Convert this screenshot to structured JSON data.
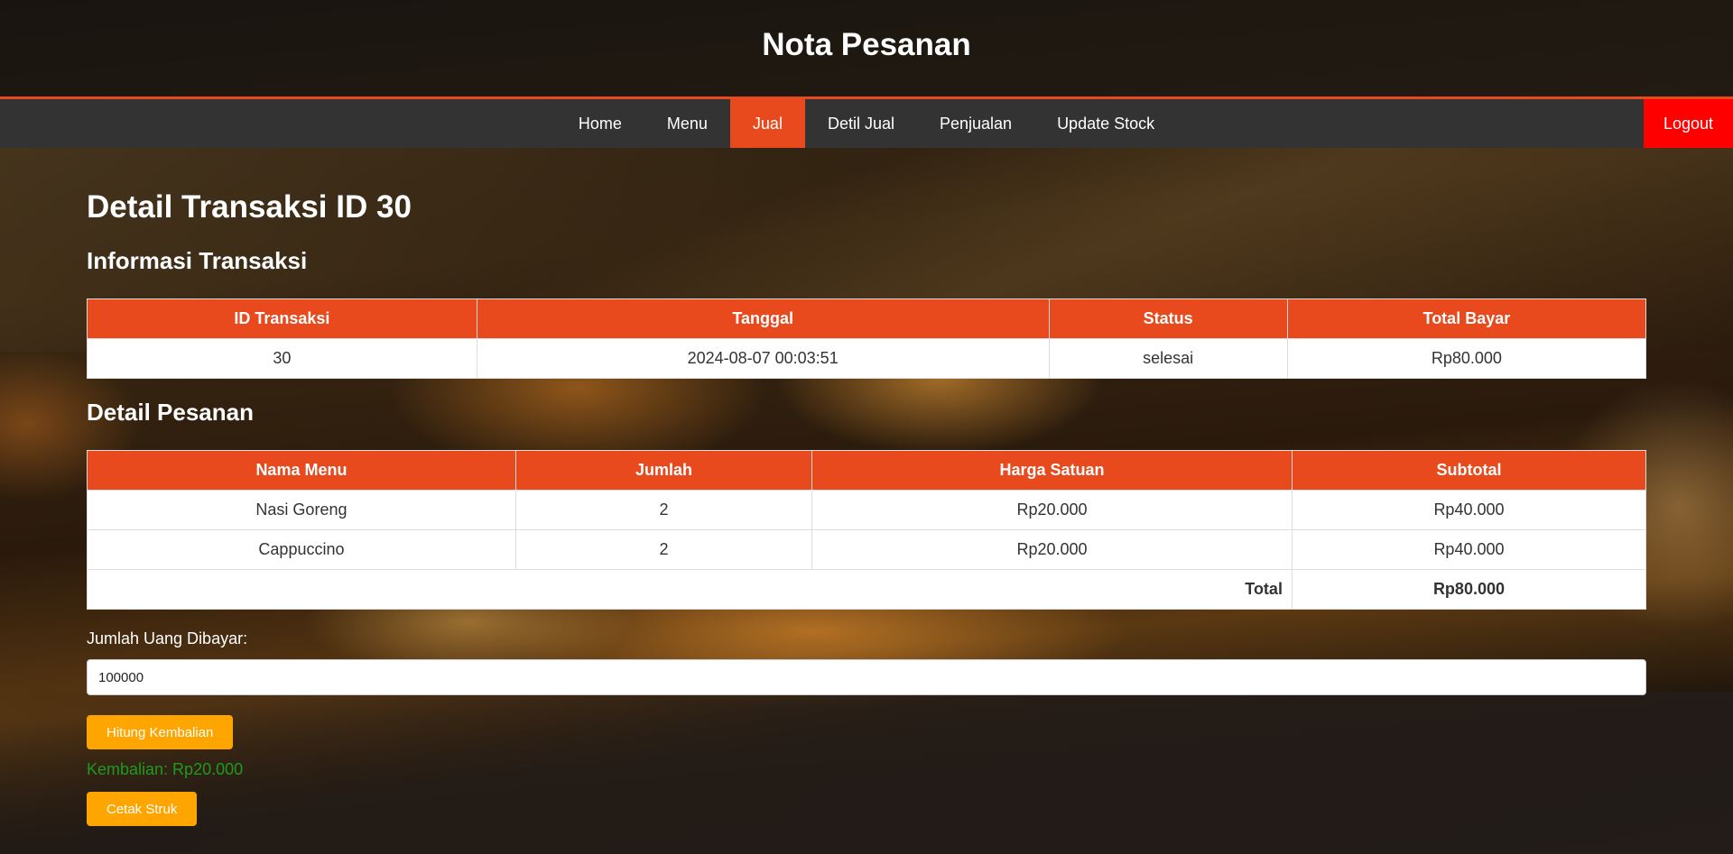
{
  "header": {
    "title": "Nota Pesanan"
  },
  "nav": {
    "items": [
      {
        "label": "Home"
      },
      {
        "label": "Menu"
      },
      {
        "label": "Jual"
      },
      {
        "label": "Detil Jual"
      },
      {
        "label": "Penjualan"
      },
      {
        "label": "Update Stock"
      }
    ],
    "active": "Jual",
    "logout": "Logout"
  },
  "page": {
    "title": "Detail Transaksi ID 30",
    "info_title": "Informasi Transaksi",
    "detail_title": "Detail Pesanan"
  },
  "info_table": {
    "headers": [
      "ID Transaksi",
      "Tanggal",
      "Status",
      "Total Bayar"
    ],
    "row": [
      "30",
      "2024-08-07 00:03:51",
      "selesai",
      "Rp80.000"
    ]
  },
  "detail_table": {
    "headers": [
      "Nama Menu",
      "Jumlah",
      "Harga Satuan",
      "Subtotal"
    ],
    "rows": [
      [
        "Nasi Goreng",
        "2",
        "Rp20.000",
        "Rp40.000"
      ],
      [
        "Cappuccino",
        "2",
        "Rp20.000",
        "Rp40.000"
      ]
    ],
    "total_label": "Total",
    "total_value": "Rp80.000"
  },
  "payment": {
    "label": "Jumlah Uang Dibayar:",
    "value": "100000",
    "calc_button": "Hitung Kembalian",
    "change_text": "Kembalian: Rp20.000",
    "print_button": "Cetak Struk"
  },
  "colors": {
    "accent": "#e8491d",
    "nav_bg": "#333333",
    "logout": "#ff0000",
    "button": "#ffa500",
    "change_text": "#1e9b1e"
  }
}
